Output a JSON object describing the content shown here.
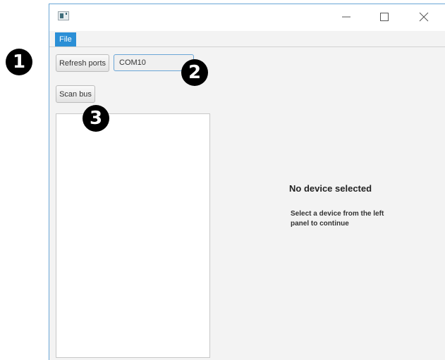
{
  "markers": {
    "one": "1",
    "two": "2",
    "three": "3"
  },
  "window": {
    "title": "",
    "controls": {
      "minimize": "minimize",
      "maximize": "maximize",
      "close": "close"
    }
  },
  "menu": {
    "file": "File"
  },
  "toolbar": {
    "refresh_label": "Refresh ports",
    "port_selected": "COM10",
    "scan_label": "Scan bus"
  },
  "devices": [],
  "placeholder": {
    "title": "No device selected",
    "message": "Select a device from the left panel to continue"
  },
  "colors": {
    "accent": "#2b8fd6",
    "window_border": "#6aa6d6",
    "background": "#f3f3f3"
  }
}
